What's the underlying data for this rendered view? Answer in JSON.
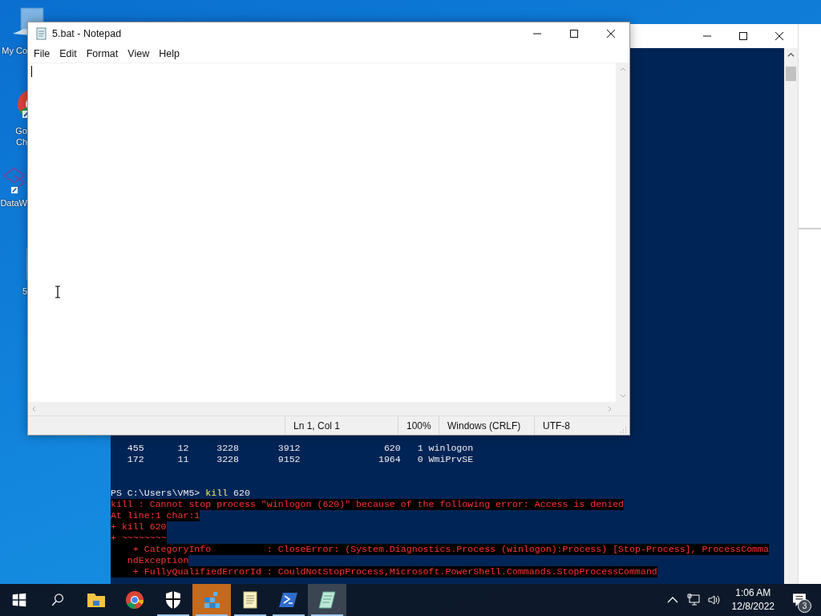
{
  "desktop": {
    "icons": [
      {
        "kind": "computer",
        "lines": [
          "My Co"
        ]
      },
      {
        "kind": "chrome",
        "lines": [
          "Go",
          "Ch"
        ]
      },
      {
        "kind": "network",
        "lines": [
          "DataW"
        ]
      },
      {
        "kind": "document",
        "lines": [
          "5"
        ]
      }
    ]
  },
  "powershell_window": {
    "console_lines": [
      {
        "kind": "output",
        "text": "   455      12     3228       3912               620   1 winlogon"
      },
      {
        "kind": "output",
        "text": "   172      11     3228       9152              1964   0 WmiPrvSE"
      },
      {
        "kind": "blank"
      },
      {
        "kind": "blank"
      },
      {
        "kind": "prompt",
        "prompt": "PS C:\\Users\\VM5> ",
        "command": "kill",
        "args": " 620"
      },
      {
        "kind": "error",
        "text": "kill : Cannot stop process \"winlogon (620)\" because of the following error: Access is denied"
      },
      {
        "kind": "error",
        "text": "At line:1 char:1"
      },
      {
        "kind": "error",
        "text": "+ kill 620"
      },
      {
        "kind": "error",
        "text": "+ ~~~~~~~~"
      },
      {
        "kind": "error",
        "text": "    + CategoryInfo          : CloseError: (System.Diagnostics.Process (winlogon):Process) [Stop-Process], ProcessComma"
      },
      {
        "kind": "error",
        "text": "   ndException"
      },
      {
        "kind": "error",
        "text": "    + FullyQualifiedErrorId : CouldNotStopProcess,Microsoft.PowerShell.Commands.StopProcessCommand"
      }
    ]
  },
  "notepad": {
    "title": "5.bat - Notepad",
    "menu": [
      "File",
      "Edit",
      "Format",
      "View",
      "Help"
    ],
    "status_bar": [
      "Ln 1, Col 1",
      "100%",
      "Windows (CRLF)",
      "UTF-8"
    ]
  },
  "taskbar": {
    "apps": [
      {
        "kind": "file-explorer",
        "running": false,
        "flashing": false,
        "selected": false
      },
      {
        "kind": "chrome",
        "running": false,
        "flashing": false,
        "selected": false
      },
      {
        "kind": "shield",
        "running": true,
        "flashing": false,
        "selected": false
      },
      {
        "kind": "cubes",
        "running": true,
        "flashing": true,
        "selected": false
      },
      {
        "kind": "notepad",
        "running": true,
        "flashing": false,
        "selected": false
      },
      {
        "kind": "powershell",
        "running": true,
        "flashing": false,
        "selected": false
      },
      {
        "kind": "notepad-green",
        "running": true,
        "flashing": false,
        "selected": true
      }
    ],
    "clock": {
      "time": "1:06 AM",
      "date": "12/8/2022"
    },
    "notifications": {
      "badge": "3"
    }
  }
}
